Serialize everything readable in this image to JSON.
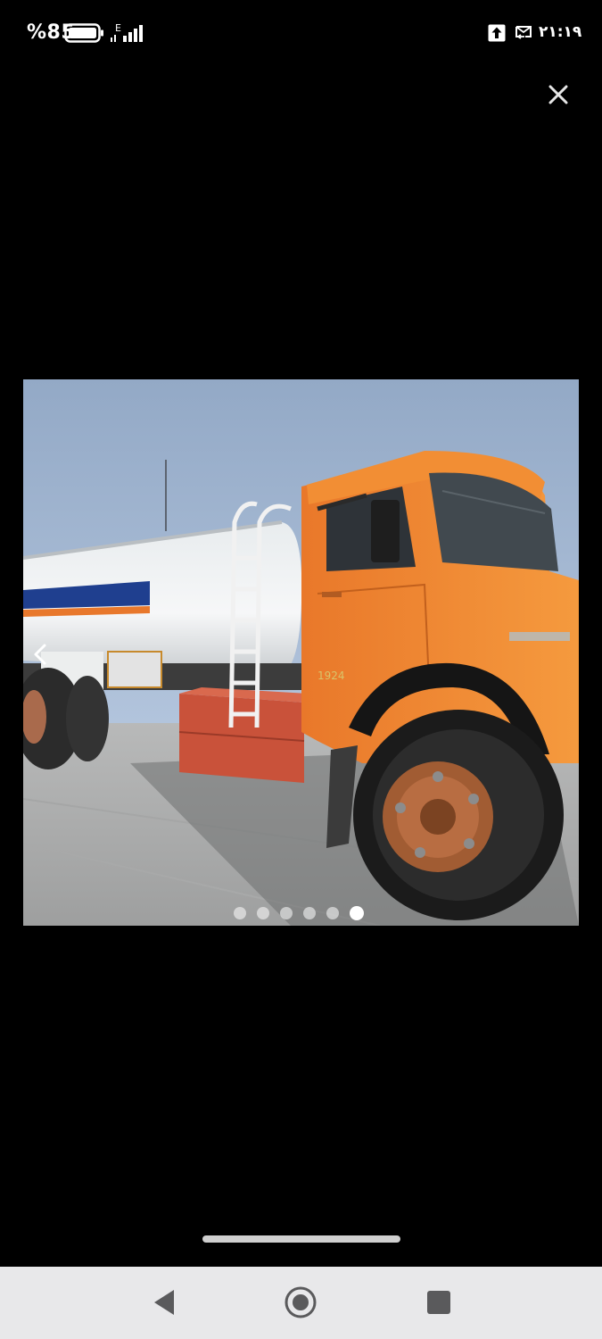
{
  "status_bar": {
    "battery_percent": "%85",
    "network_type": "E",
    "clock": "۲۱:۱۹",
    "icons": [
      "battery-icon",
      "signal-icon",
      "upload-icon",
      "message-icon"
    ]
  },
  "viewer": {
    "close_icon": "close-icon",
    "prev_icon": "chevron-left-icon",
    "image_subject": "orange truck with white tanker trailer",
    "carousel": {
      "total": 6,
      "active_index": 5
    }
  },
  "nav_bar": {
    "icons": [
      "back-icon",
      "home-icon",
      "recents-icon"
    ]
  },
  "colors": {
    "background": "#000000",
    "nav_bar": "#e8e8ea",
    "truck_cab": "#f08a33",
    "sky": "#9fb4cf"
  }
}
